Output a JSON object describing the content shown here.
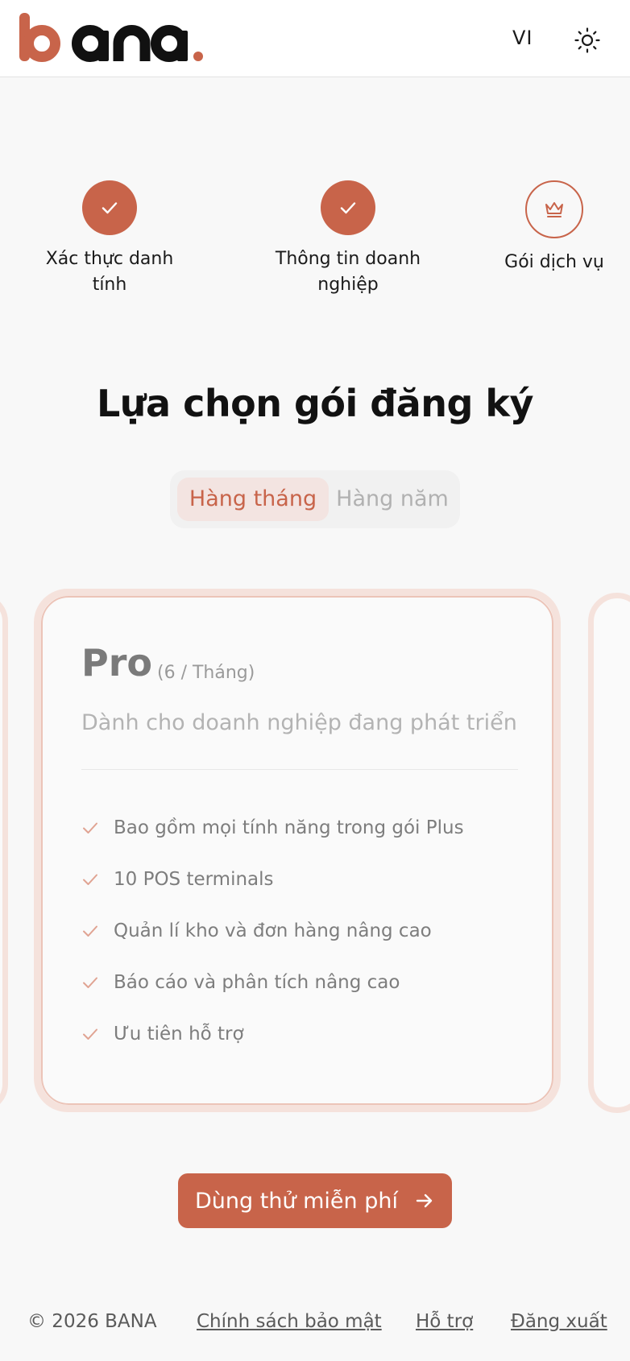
{
  "header": {
    "brand": "bana.",
    "language": "VI",
    "brand_color": "#c8644a"
  },
  "stepper": {
    "steps": [
      {
        "label": "Xác thực danh tính",
        "status": "completed",
        "icon": "check-icon"
      },
      {
        "label": "Thông tin doanh nghiệp",
        "status": "completed",
        "icon": "check-icon"
      },
      {
        "label": "Gói dịch vụ",
        "status": "current",
        "icon": "crown-icon"
      }
    ]
  },
  "main": {
    "title": "Lựa chọn gói đăng ký",
    "billing_toggle": {
      "options": [
        "Hàng tháng",
        "Hàng năm"
      ],
      "selected": "Hàng tháng"
    },
    "plan": {
      "name": "Pro",
      "period": "(6 / Tháng)",
      "description": "Dành cho doanh nghiệp đang phát triển",
      "features": [
        "Bao gồm mọi tính năng trong gói Plus",
        "10 POS terminals",
        "Quản lí kho và đơn hàng nâng cao",
        "Báo cáo và phân tích nâng cao",
        "Ưu tiên hỗ trợ"
      ]
    },
    "cta_label": "Dùng thử miễn phí"
  },
  "footer": {
    "copyright": "© 2026 BANA",
    "links": [
      "Chính sách bảo mật",
      "Hỗ trợ",
      "Đăng xuất"
    ]
  }
}
